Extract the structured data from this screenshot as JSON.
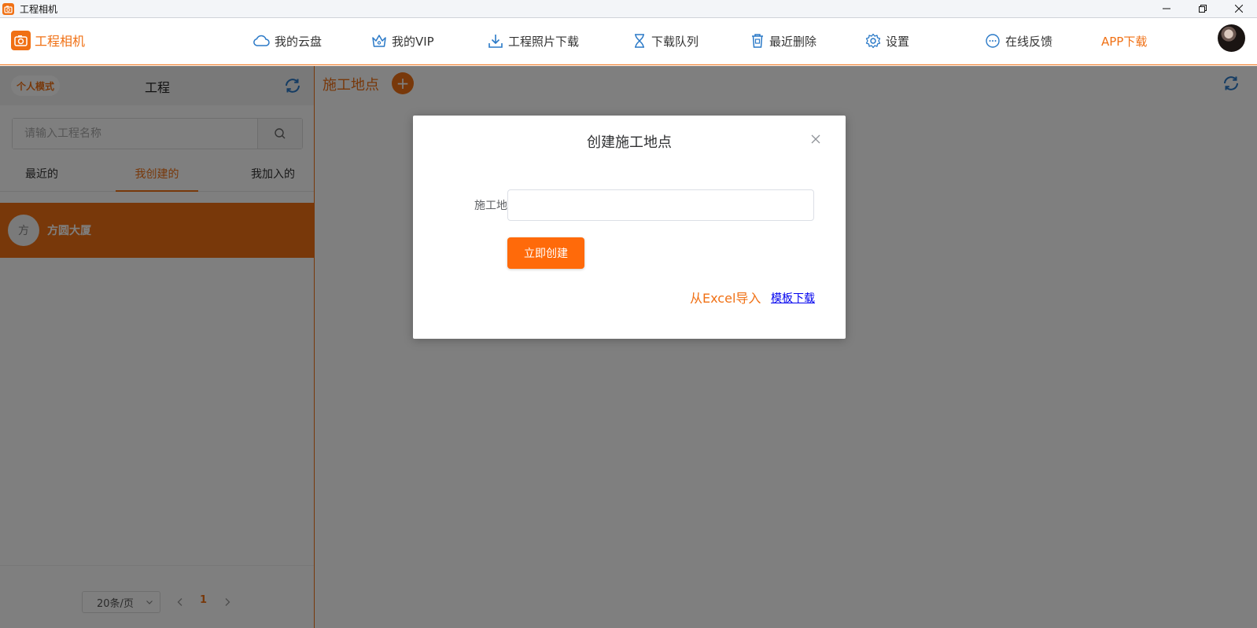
{
  "window": {
    "title": "工程相机"
  },
  "nav": {
    "brand": "工程相机",
    "items": [
      {
        "label": "我的云盘",
        "icon": "cloud-icon"
      },
      {
        "label": "我的VIP",
        "icon": "crown-icon"
      },
      {
        "label": "工程照片下载",
        "icon": "download-icon"
      },
      {
        "label": "下载队列",
        "icon": "hourglass-icon"
      },
      {
        "label": "最近删除",
        "icon": "trash-icon"
      },
      {
        "label": "设置",
        "icon": "gear-icon"
      },
      {
        "label": "在线反馈",
        "icon": "chat-icon"
      }
    ],
    "app_download": "APP下载"
  },
  "left": {
    "mode_badge": "个人模式",
    "title": "工程",
    "search_placeholder": "请输入工程名称",
    "tabs": [
      "最近的",
      "我创建的",
      "我加入的"
    ],
    "active_tab": "我创建的",
    "projects": [
      {
        "avatar_char": "方",
        "name": "方圆大厦"
      }
    ],
    "page_size": "20条/页",
    "current_page": "1"
  },
  "right": {
    "title": "施工地点",
    "add_symbol": "+"
  },
  "modal": {
    "title": "创建施工地点",
    "field_label": "施工地点",
    "field_value": "",
    "create_button": "立即创建",
    "import_link": "从Excel导入",
    "template_link": "模板下载"
  },
  "colors": {
    "accent": "#f07014",
    "button": "#ff6a0a",
    "icon_blue": "#2a79c7",
    "link": "#0000ee"
  }
}
